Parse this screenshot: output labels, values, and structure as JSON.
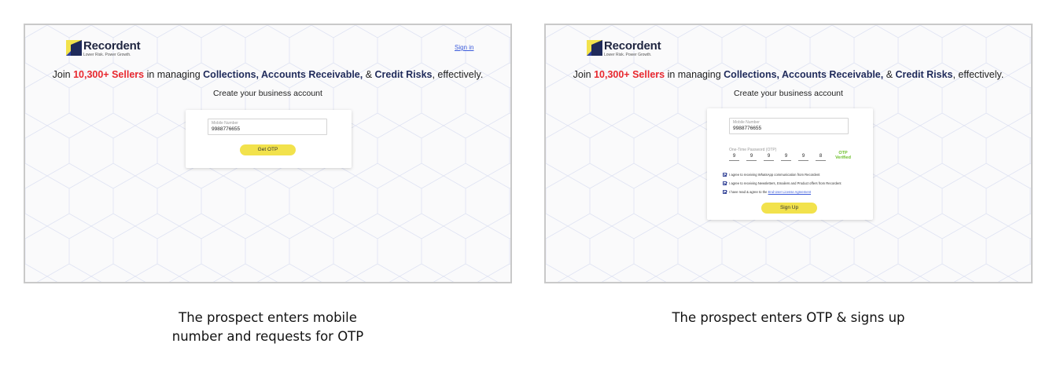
{
  "brand": {
    "name": "Recordent",
    "tagline": "Lower Risk. Power Growth.",
    "colors": {
      "navy": "#1f2a5a",
      "red": "#e8282f",
      "yellow": "#f2e24c",
      "blue_link": "#3b5bdb",
      "green": "#6cbf2a"
    }
  },
  "left_screen": {
    "signin_label": "Sign in",
    "headline": {
      "prefix": "Join ",
      "highlight_sellers": "10,300+ Sellers",
      "mid": " in managing ",
      "highlight_collections": "Collections, Accounts Receivable,",
      "amp": " & ",
      "highlight_credit": "Credit Risks",
      "suffix": ", effectively."
    },
    "subheading": "Create your business account",
    "mobile_field": {
      "label": "Mobile Number",
      "value": "9988776655"
    },
    "button_label": "Get OTP"
  },
  "right_screen": {
    "headline": {
      "prefix": "Join ",
      "highlight_sellers": "10,300+ Sellers",
      "mid": " in managing ",
      "highlight_collections": "Collections, Accounts Receivable,",
      "amp": " & ",
      "highlight_credit": "Credit Risks",
      "suffix": ", effectively."
    },
    "subheading": "Create your business account",
    "mobile_field": {
      "label": "Mobile Number",
      "value": "9988776655"
    },
    "otp_label": "One-Time Password (OTP)",
    "otp_digits": [
      "9",
      "9",
      "9",
      "9",
      "9",
      "8"
    ],
    "otp_status_line1": "OTP",
    "otp_status_line2": "Verified",
    "checkboxes": [
      {
        "text": "I agree to receiving WhatsApp communication from Recordent",
        "checked": true
      },
      {
        "text": "I agree to receiving Newsletters, Emailers and Product offers from Recordent",
        "checked": true
      },
      {
        "text": "I have read & agree to the ",
        "link": "End User License Agreement",
        "checked": true
      }
    ],
    "button_label": "Sign Up"
  },
  "captions": {
    "left_line1": "The prospect enters mobile",
    "left_line2": "number and requests for OTP",
    "right": "The prospect enters OTP & signs up"
  }
}
